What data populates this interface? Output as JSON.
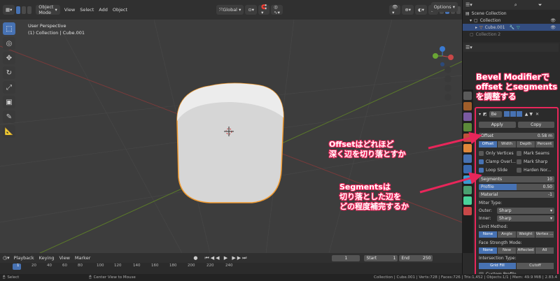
{
  "header": {
    "mode": "Object Mode",
    "menus": [
      "View",
      "Select",
      "Add",
      "Object"
    ],
    "orientation": "Global",
    "options": "Options"
  },
  "viewport": {
    "perspective": "User Perspective",
    "collection": "(1) Collection | Cube.001"
  },
  "outliner": {
    "items": [
      "Scene Collection",
      "Collection",
      "Cube.001",
      "Collection 2"
    ]
  },
  "modifier": {
    "name": "Be",
    "apply": "Apply",
    "copy": "Copy",
    "offset_label": "Offset",
    "offset_value": "0.58 m",
    "width_types": [
      "Offset",
      "Width",
      "Depth",
      "Percent"
    ],
    "checks": [
      {
        "label": "Only Vertices",
        "on": false
      },
      {
        "label": "Mark Seams",
        "on": false
      },
      {
        "label": "Clamp Overl...",
        "on": true
      },
      {
        "label": "Mark Sharp",
        "on": false
      },
      {
        "label": "Loop Slide",
        "on": true
      },
      {
        "label": "Harden Nor...",
        "on": false
      }
    ],
    "segments_label": "Segments",
    "segments_value": "10",
    "profile_label": "Profile",
    "profile_value": "0.50",
    "material_label": "Material",
    "material_value": "-1",
    "miter_type": "Miter Type:",
    "outer_label": "Outer:",
    "outer_value": "Sharp",
    "inner_label": "Inner:",
    "inner_value": "Sharp",
    "limit_method": "Limit Method:",
    "limit_options": [
      "None",
      "Angle",
      "Weight",
      "Vertex ..."
    ],
    "face_strength": "Face Strength Mode:",
    "face_options": [
      "None",
      "New",
      "Affected",
      "All"
    ],
    "intersection": "Intersection Type:",
    "intersection_options": [
      "Grid Fill",
      "Cutoff"
    ],
    "custom_profile": "Custom Profile"
  },
  "timeline": {
    "menus": [
      "Playback",
      "Keying",
      "View",
      "Marker"
    ],
    "current_frame": "1",
    "start_label": "Start",
    "start": "1",
    "end_label": "End",
    "end": "250",
    "ticks": [
      "1",
      "20",
      "40",
      "60",
      "80",
      "100",
      "120",
      "140",
      "160",
      "180",
      "200",
      "220",
      "240"
    ]
  },
  "status": {
    "left": "Select",
    "middle": "Center View to Mouse",
    "right": "Collection | Cube.001 | Verts:728 | Faces:726 | Tris:1,452 | Objects:1/1 | Mem: 49.9 MiB | 2.83.4"
  },
  "annotations": {
    "title": [
      "Bevel Modifierで",
      "offset とsegments",
      "を調整する"
    ],
    "offset_note": [
      "Offsetはどれほど",
      "深く辺を切り落とすか"
    ],
    "segments_note": [
      "Segmentsは",
      "切り落とした辺を",
      "どの程度補完するか"
    ]
  },
  "colors": {
    "accent": "#4772b3",
    "highlight": "#e8265a",
    "cube_outline": "#f29a2e"
  }
}
